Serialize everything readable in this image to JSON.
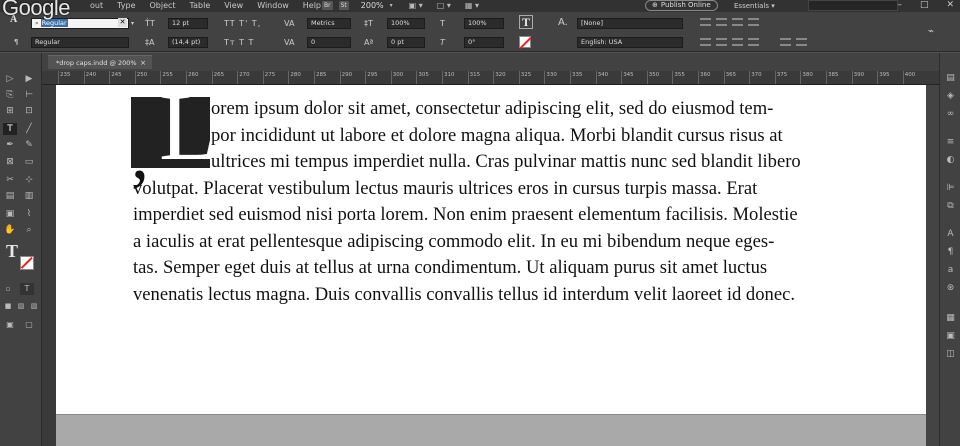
{
  "app": {
    "logo": "Google",
    "menu": [
      "out",
      "Type",
      "Object",
      "Table",
      "View",
      "Window",
      "Help"
    ],
    "bridge_chip": "Br",
    "stock_chip": "St",
    "zoom": "200%",
    "publish_label": "Publish Online",
    "workspace": "Essentials"
  },
  "control": {
    "font_search_value": "Regular",
    "font_search_selected": "Regular",
    "font_style": "Regular",
    "font_size": "12 pt",
    "leading": "(14,4 pt)",
    "kerning": "Metrics",
    "tracking": "0",
    "vscale": "100%",
    "hscale": "100%",
    "baseline": "0 pt",
    "skew": "0°",
    "char_style": "[None]",
    "language": "English: USA"
  },
  "document": {
    "tab_title": "*drop caps.indd @ 200%",
    "tab_close": "×",
    "ruler_ticks": [
      "235",
      "240",
      "245",
      "250",
      "255",
      "260",
      "265",
      "270",
      "275",
      "280",
      "285",
      "290",
      "295",
      "300",
      "305",
      "310",
      "315",
      "320",
      "325",
      "330",
      "335",
      "340",
      "345",
      "350",
      "355",
      "360",
      "365",
      "370",
      "375",
      "380",
      "385",
      "390",
      "395",
      "400"
    ],
    "drop_cap": "L",
    "drop_cap_punct": ",",
    "lines": [
      "orem ipsum dolor sit amet, consectetur adipiscing elit, sed do eiusmod tem-",
      "por incididunt ut labore et dolore magna aliqua. Morbi blandit cursus risus at",
      "ultrices mi tempus imperdiet nulla. Cras pulvinar mattis nunc sed blandit libero",
      "volutpat. Placerat vestibulum lectus mauris ultrices eros in cursus turpis massa. Erat",
      "imperdiet sed euismod nisi porta lorem. Non enim praesent elementum facilisis. Molestie",
      "a iaculis at erat pellentesque adipiscing commodo elit. In eu mi bibendum neque eges-",
      "tas. Semper eget duis at tellus at urna condimentum. Ut aliquam purus sit amet luctus",
      "venenatis lectus magna. Duis convallis convallis tellus id interdum velit laoreet id donec."
    ]
  },
  "colors": {
    "ui_dark": "#323232",
    "ui_panel": "#424242",
    "canvas": "#535353",
    "page": "#ffffff",
    "dropcap_bg": "#222222"
  }
}
